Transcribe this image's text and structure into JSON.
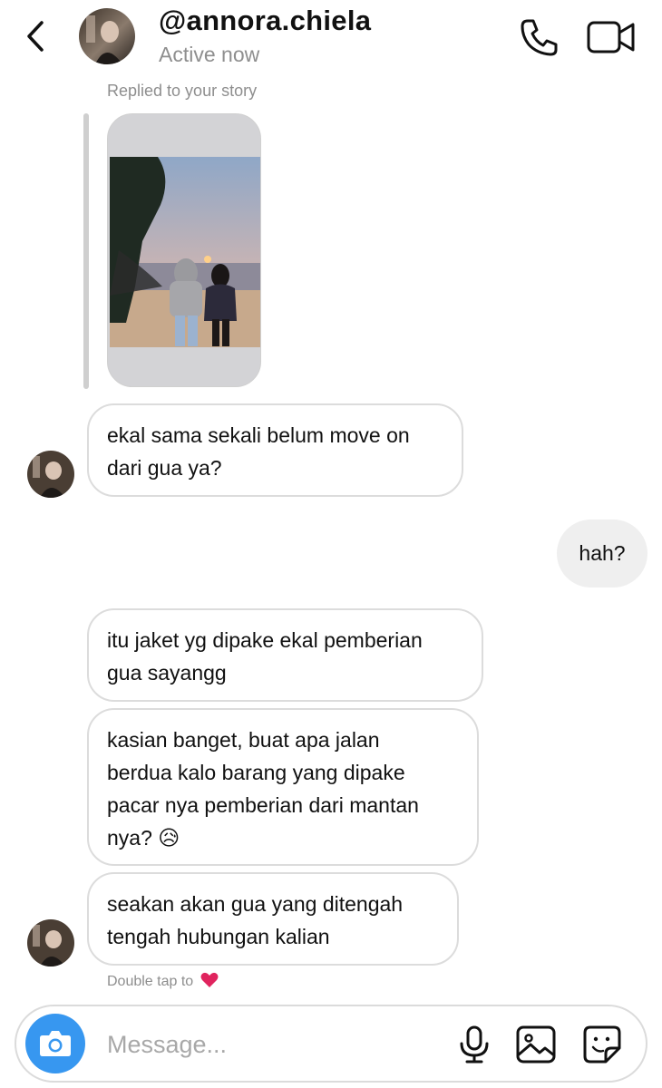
{
  "header": {
    "username": "@annora.chiela",
    "status": "Active now"
  },
  "story_reply": {
    "caption": "Replied to your story"
  },
  "messages": [
    {
      "text_line1": "ekal sama sekali belum move on",
      "text_line2": "dari gua ya?"
    },
    {
      "text": "hah?"
    },
    {
      "text_line1": "itu jaket yg dipake ekal pemberian",
      "text_line2": "gua sayangg"
    },
    {
      "text_line1": "kasian banget, buat apa jalan",
      "text_line2": "berdua kalo barang yang dipake",
      "text_line3": "pacar nya pemberian dari mantan",
      "text_line4": "nya? 😥"
    },
    {
      "text_line1": "seakan akan gua yang ditengah",
      "text_line2": "tengah hubungan kalian"
    }
  ],
  "hint": {
    "text": "Double tap to"
  },
  "composer": {
    "placeholder": "Message..."
  },
  "colors": {
    "accent": "#3797f0",
    "incoming_border": "#dcdcdc",
    "outgoing_bg": "#efefef",
    "muted_text": "#8e8e8e"
  },
  "icons": [
    "back-chevron-icon",
    "phone-icon",
    "video-camera-icon",
    "camera-icon",
    "microphone-icon",
    "gallery-icon",
    "sticker-icon",
    "heart-icon"
  ]
}
